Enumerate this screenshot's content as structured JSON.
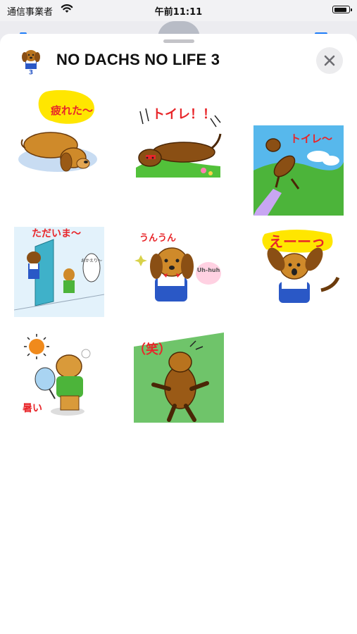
{
  "status_bar": {
    "carrier": "通信事業者",
    "time": "午前11:11",
    "battery_level": 0.9
  },
  "sheet": {
    "title": "NO DACHS NO LIFE 3",
    "app_icon_badge": "3"
  },
  "stickers": [
    {
      "caption": "疲れた〜",
      "icon": "tired-dog-sticker"
    },
    {
      "caption": "トイレ！！",
      "icon": "toilet-dog-sticker"
    },
    {
      "caption": "トイレ〜",
      "icon": "toilet-running-dog-sticker"
    },
    {
      "caption": "ただいま〜",
      "icon": "im-home-dog-sticker",
      "speech": "おかえり〜"
    },
    {
      "caption": "うんうん",
      "icon": "nodding-dog-sticker",
      "speech": "Uh-huh"
    },
    {
      "caption": "えーーっ",
      "icon": "surprised-dog-sticker"
    },
    {
      "caption": "暑い",
      "icon": "hot-dog-sticker"
    },
    {
      "caption": "（笑）",
      "icon": "laughing-dog-sticker"
    }
  ],
  "colors": {
    "caption_red": "#e8262a",
    "caption_bubble_yellow": "#ffe600",
    "dog_brown": "#b8731e",
    "grass_green": "#4cb43a",
    "sky_blue": "#57b8ec"
  }
}
